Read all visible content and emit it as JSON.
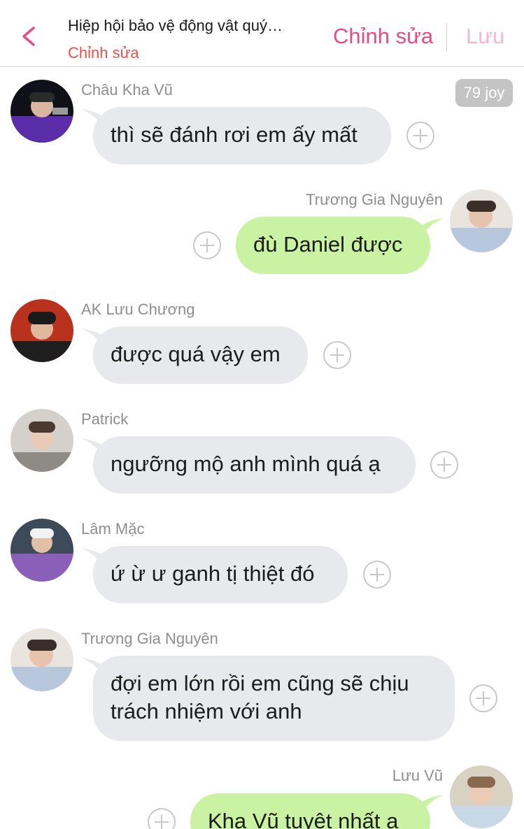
{
  "header": {
    "title": "Hiệp hội bảo vệ động vật quý…",
    "subtitle": "Chỉnh sửa",
    "edit_label": "Chỉnh sửa",
    "save_label": "Lưu"
  },
  "messages": [
    {
      "sender": "Châu Kha Vũ",
      "text": "thì sẽ đánh rơi em ấy mất",
      "side": "left",
      "badge": "79 joy"
    },
    {
      "sender": "Trương Gia Nguyên",
      "text": "đù Daniel được",
      "side": "right"
    },
    {
      "sender": "AK Lưu Chương",
      "text": "được quá vậy em",
      "side": "left"
    },
    {
      "sender": "Patrick",
      "text": "ngưỡng mộ anh mình quá ạ",
      "side": "left"
    },
    {
      "sender": "Lâm Mặc",
      "text": "ứ ừ ư ganh tị thiệt đó",
      "side": "left"
    },
    {
      "sender": "Trương Gia Nguyên",
      "text_lines": [
        "đợi em lớn rồi em cũng sẽ chịu",
        "trách nhiệm với anh"
      ],
      "side": "left"
    },
    {
      "sender": "Lưu Vũ",
      "text": "Kha Vũ tuyệt nhất ạ",
      "side": "right"
    }
  ],
  "colors": {
    "accent_pink": "#e44d85",
    "subtitle_red": "#e8504b",
    "save_disabled": "#f4b7cc",
    "bubble_left": "#e7e9ec",
    "bubble_right": "#c9f2a2"
  },
  "icons": [
    "back-chevron-icon",
    "add-reaction-icon"
  ]
}
